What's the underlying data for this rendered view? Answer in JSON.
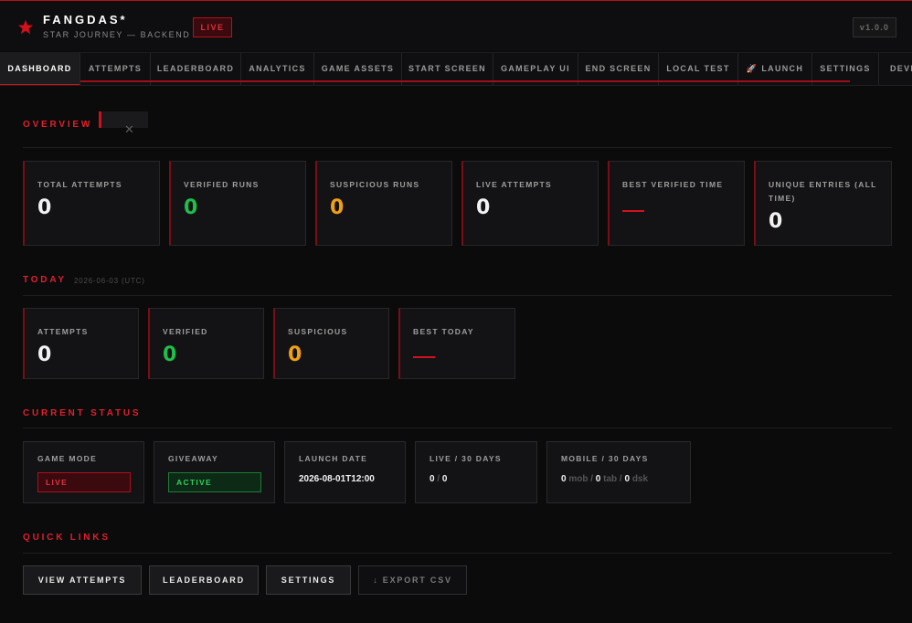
{
  "header": {
    "title": "FANGDAS*",
    "subtitle": "STAR JOURNEY — BACKEND",
    "live_badge": "LIVE",
    "version": "v1.0.0",
    "accent_color": "#c8121e"
  },
  "tabs": [
    {
      "label": "DASHBOARD",
      "active": true
    },
    {
      "label": "ATTEMPTS"
    },
    {
      "label": "LEADERBOARD"
    },
    {
      "label": "ANALYTICS"
    },
    {
      "label": "GAME ASSETS"
    },
    {
      "label": "START SCREEN"
    },
    {
      "label": "GAMEPLAY UI"
    },
    {
      "label": "END SCREEN"
    },
    {
      "label": "LOCAL TEST"
    },
    {
      "label": "LAUNCH",
      "icon": "rocket-icon",
      "icon_glyph": "🚀"
    },
    {
      "label": "SETTINGS"
    },
    {
      "label": "DEVE"
    }
  ],
  "toast": {
    "close_glyph": "✕"
  },
  "overview": {
    "title": "OVERVIEW",
    "cards": [
      {
        "label": "TOTAL ATTEMPTS",
        "value": "0",
        "tone": "white"
      },
      {
        "label": "VERIFIED RUNS",
        "value": "0",
        "tone": "green"
      },
      {
        "label": "SUSPICIOUS RUNS",
        "value": "0",
        "tone": "orange"
      },
      {
        "label": "LIVE ATTEMPTS",
        "value": "0",
        "tone": "white"
      },
      {
        "label": "BEST VERIFIED TIME",
        "value": "—",
        "tone": "dash"
      },
      {
        "label": "UNIQUE ENTRIES (ALL TIME)",
        "value": "0",
        "tone": "white"
      }
    ]
  },
  "today": {
    "title": "TODAY",
    "date": "2026-06-03 (UTC)",
    "cards": [
      {
        "label": "ATTEMPTS",
        "value": "0",
        "tone": "white"
      },
      {
        "label": "VERIFIED",
        "value": "0",
        "tone": "green"
      },
      {
        "label": "SUSPICIOUS",
        "value": "0",
        "tone": "orange"
      },
      {
        "label": "BEST TODAY",
        "value": "—",
        "tone": "dash"
      }
    ]
  },
  "current_status": {
    "title": "CURRENT STATUS",
    "game_mode": {
      "label": "GAME MODE",
      "value": "LIVE"
    },
    "giveaway": {
      "label": "GIVEAWAY",
      "value": "ACTIVE"
    },
    "launch_date": {
      "label": "LAUNCH DATE",
      "value": "2026-08-01T12:00"
    },
    "live_30": {
      "label": "LIVE / 30 DAYS",
      "a": "0",
      "sep": "/",
      "b": "0"
    },
    "mobile_30": {
      "label": "MOBILE / 30 DAYS",
      "mob": "0",
      "mob_label": "mob",
      "tab": "0",
      "tab_label": "tab",
      "dsk": "0",
      "dsk_label": "dsk",
      "sep": "/"
    }
  },
  "quick_links": {
    "title": "QUICK LINKS",
    "view_attempts": "VIEW ATTEMPTS",
    "leaderboard": "LEADERBOARD",
    "settings": "SETTINGS",
    "export_csv": "↓ EXPORT CSV"
  }
}
